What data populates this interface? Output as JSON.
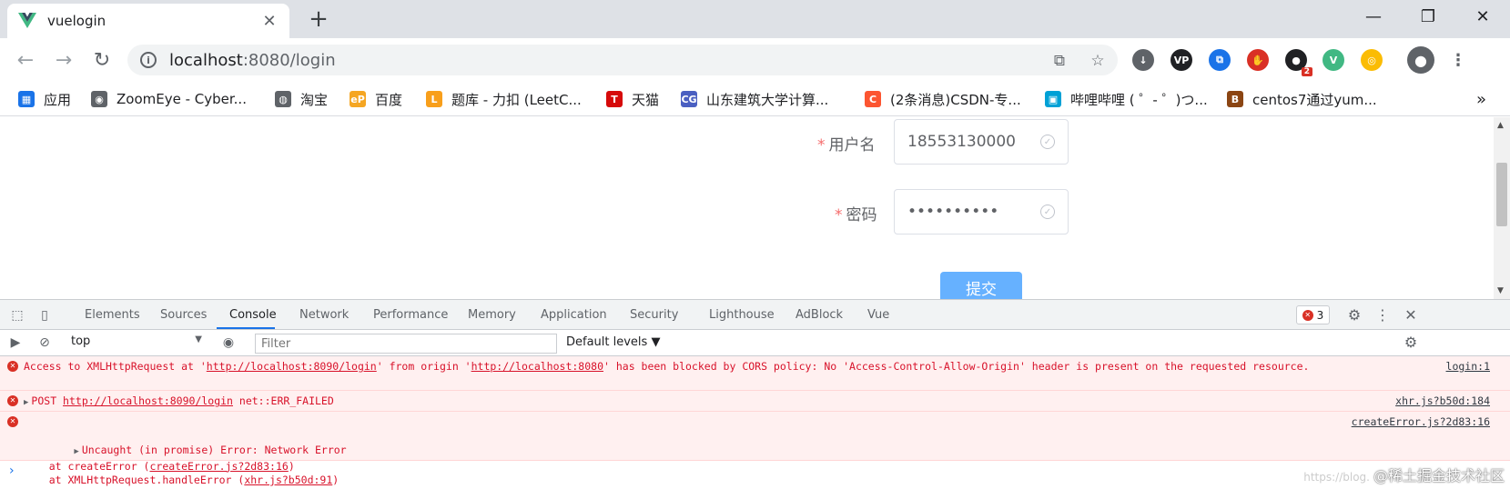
{
  "tab": {
    "title": "vuelogin",
    "close": "✕"
  },
  "newtab": "+",
  "window": {
    "minimize": "—",
    "restore": "❐",
    "close": "✕"
  },
  "toolbar": {
    "url_host": "localhost",
    "url_rest": ":8080/login"
  },
  "extensions": [
    {
      "name": "download-icon",
      "color": "#5f6368",
      "glyph": "↓"
    },
    {
      "name": "vp-icon",
      "color": "#202124",
      "glyph": "VP"
    },
    {
      "name": "copy-ext-icon",
      "color": "#1a73e8",
      "glyph": "⧉"
    },
    {
      "name": "adblock-icon",
      "color": "#d93025",
      "glyph": "✋"
    },
    {
      "name": "ext-badge-icon",
      "color": "#202124",
      "glyph": "●",
      "badge": "2"
    },
    {
      "name": "vue-devtools-icon",
      "color": "#41b883",
      "glyph": "V"
    },
    {
      "name": "chrome-ext-icon",
      "color": "#fbbc04",
      "glyph": "◎"
    }
  ],
  "bookmarks": [
    {
      "label": "应用",
      "icon_color": "#1a73e8",
      "icon": "▦"
    },
    {
      "label": "ZoomEye - Cyber...",
      "icon_color": "#5f6368",
      "icon": "◉"
    },
    {
      "label": "淘宝",
      "icon_color": "#5f6368",
      "icon": "◍"
    },
    {
      "label": "百度",
      "icon_color": "#f5a623",
      "icon": "eP"
    },
    {
      "label": "题库 - 力扣 (LeetC...",
      "icon_color": "#f89f1b",
      "icon": "L"
    },
    {
      "label": "天猫",
      "icon_color": "#d60a0a",
      "icon": "T"
    },
    {
      "label": "山东建筑大学计算...",
      "icon_color": "#4a5fc1",
      "icon": "CG"
    },
    {
      "label": "(2条消息)CSDN-专...",
      "icon_color": "#fc5531",
      "icon": "C"
    },
    {
      "label": "哔哩哔哩 ( ゜- ゜)つ...",
      "icon_color": "#00a1d6",
      "icon": "▣"
    },
    {
      "label": "centos7通过yum...",
      "icon_color": "#8b4513",
      "icon": "B"
    }
  ],
  "bookmarks_more": "»",
  "form": {
    "required_mark": "*",
    "username_label": "用户名",
    "username_value": "18553130000",
    "password_label": "密码",
    "password_value": "••••••••••",
    "submit_label": "提交"
  },
  "devtools": {
    "tabs": [
      "Elements",
      "Sources",
      "Console",
      "Network",
      "Performance",
      "Memory",
      "Application",
      "Security",
      "Lighthouse",
      "AdBlock",
      "Vue"
    ],
    "active_tab": "Console",
    "error_count": "3",
    "context": "top",
    "filter_placeholder": "Filter",
    "levels": "Default levels ▼"
  },
  "console": {
    "msg1": {
      "pre": "Access to XMLHttpRequest at '",
      "url1": "http://localhost:8090/login",
      "mid": "' from origin '",
      "url2": "http://localhost:8080",
      "post": "' has been blocked by CORS policy: No 'Access-Control-Allow-Origin' header is present on the requested resource.",
      "src": "login:1"
    },
    "msg2": {
      "pre": "POST ",
      "url": "http://localhost:8090/login",
      "post": " net::ERR_FAILED",
      "src": "xhr.js?b50d:184"
    },
    "msg3": {
      "line1": "Uncaught (in promise) Error: Network Error",
      "line2_pre": "    at createError (",
      "line2_link": "createError.js?2d83:16",
      "line2_post": ")",
      "line3_pre": "    at XMLHttpRequest.handleError (",
      "line3_link": "xhr.js?b50d:91",
      "line3_post": ")",
      "src": "createError.js?2d83:16"
    },
    "prompt": "›"
  },
  "watermark": {
    "faint": "https://blog.",
    "text": "@稀土掘金技术社区"
  }
}
